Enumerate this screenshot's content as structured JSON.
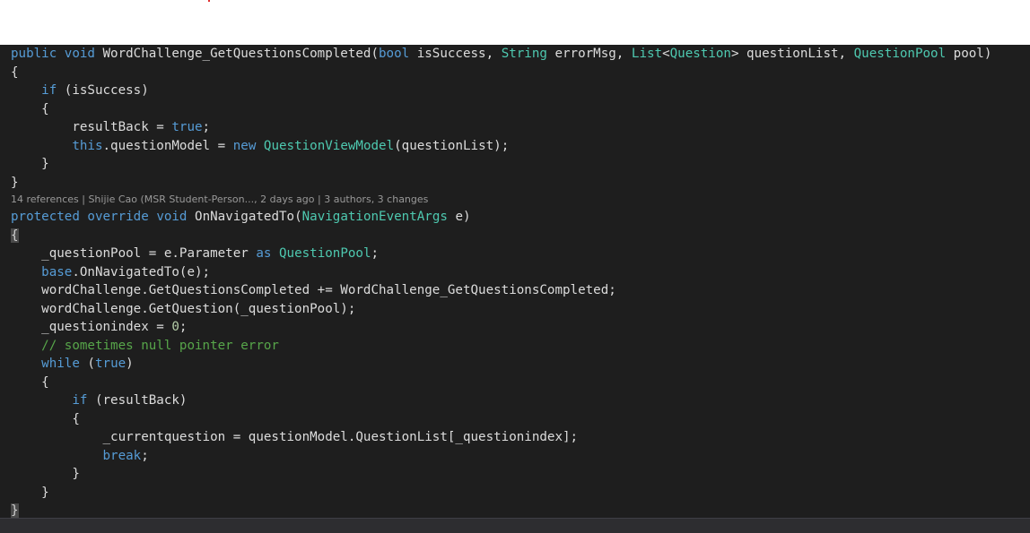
{
  "code": {
    "lines": [
      [
        {
          "t": "public",
          "c": "kw"
        },
        {
          "t": " "
        },
        {
          "t": "void",
          "c": "kw"
        },
        {
          "t": " WordChallenge_GetQuestionsCompleted("
        },
        {
          "t": "bool",
          "c": "kw"
        },
        {
          "t": " isSuccess, "
        },
        {
          "t": "String",
          "c": "ty"
        },
        {
          "t": " errorMsg, "
        },
        {
          "t": "List",
          "c": "ty"
        },
        {
          "t": "<"
        },
        {
          "t": "Question",
          "c": "ty"
        },
        {
          "t": "> questionList, "
        },
        {
          "t": "QuestionPool",
          "c": "ty"
        },
        {
          "t": " pool)"
        }
      ],
      [
        {
          "t": "{"
        }
      ],
      [
        {
          "t": "    "
        },
        {
          "t": "if",
          "c": "kw"
        },
        {
          "t": " (isSuccess)"
        }
      ],
      [
        {
          "t": "    {"
        }
      ],
      [
        {
          "t": "        resultBack = "
        },
        {
          "t": "true",
          "c": "kw"
        },
        {
          "t": ";"
        }
      ],
      [
        {
          "t": "        "
        },
        {
          "t": "this",
          "c": "kw"
        },
        {
          "t": ".questionModel = "
        },
        {
          "t": "new",
          "c": "kw"
        },
        {
          "t": " "
        },
        {
          "t": "QuestionViewModel",
          "c": "ty"
        },
        {
          "t": "(questionList);"
        }
      ],
      [
        {
          "t": "    }"
        }
      ],
      [
        {
          "t": "}"
        }
      ],
      {
        "lens": "14 references | Shijie Cao (MSR Student-Person..., 2 days ago | 3 authors, 3 changes"
      },
      [
        {
          "t": "protected",
          "c": "kw"
        },
        {
          "t": " "
        },
        {
          "t": "override",
          "c": "kw"
        },
        {
          "t": " "
        },
        {
          "t": "void",
          "c": "kw"
        },
        {
          "t": " OnNavigatedTo("
        },
        {
          "t": "NavigationEventArgs",
          "c": "ty"
        },
        {
          "t": " e)"
        }
      ],
      [
        {
          "t": "{",
          "c": "brace-hl"
        }
      ],
      [
        {
          "t": "    _questionPool = e.Parameter "
        },
        {
          "t": "as",
          "c": "kw"
        },
        {
          "t": " "
        },
        {
          "t": "QuestionPool",
          "c": "ty"
        },
        {
          "t": ";"
        }
      ],
      [
        {
          "t": "    "
        },
        {
          "t": "base",
          "c": "kw"
        },
        {
          "t": ".OnNavigatedTo(e);"
        }
      ],
      [
        {
          "t": "    wordChallenge.GetQuestionsCompleted += WordChallenge_GetQuestionsCompleted;"
        }
      ],
      [
        {
          "t": "    wordChallenge.GetQuestion(_questionPool);"
        }
      ],
      [
        {
          "t": "    _questionindex = "
        },
        {
          "t": "0",
          "c": "nm"
        },
        {
          "t": ";"
        }
      ],
      [
        {
          "t": "    "
        },
        {
          "t": "// sometimes null pointer error",
          "c": "cm"
        }
      ],
      [
        {
          "t": "    "
        },
        {
          "t": "while",
          "c": "kw"
        },
        {
          "t": " ("
        },
        {
          "t": "true",
          "c": "kw"
        },
        {
          "t": ")"
        }
      ],
      [
        {
          "t": "    {"
        }
      ],
      [
        {
          "t": "        "
        },
        {
          "t": "if",
          "c": "kw"
        },
        {
          "t": " (resultBack)"
        }
      ],
      [
        {
          "t": "        {"
        }
      ],
      [
        {
          "t": "            _currentquestion = questionModel.QuestionList[_questionindex];"
        }
      ],
      [
        {
          "t": "            "
        },
        {
          "t": "break",
          "c": "kw"
        },
        {
          "t": ";"
        }
      ],
      [
        {
          "t": "        }"
        }
      ],
      [
        {
          "t": "    }"
        }
      ],
      [
        {
          "t": "}",
          "c": "brace-hl"
        }
      ]
    ]
  },
  "colors": {
    "editor_background": "#1e1e1e",
    "keyword": "#569cd6",
    "type": "#4ec9b0",
    "comment": "#57a64a",
    "number": "#b5cea8",
    "default_text": "#dcdcdc",
    "codelens": "#999999"
  }
}
